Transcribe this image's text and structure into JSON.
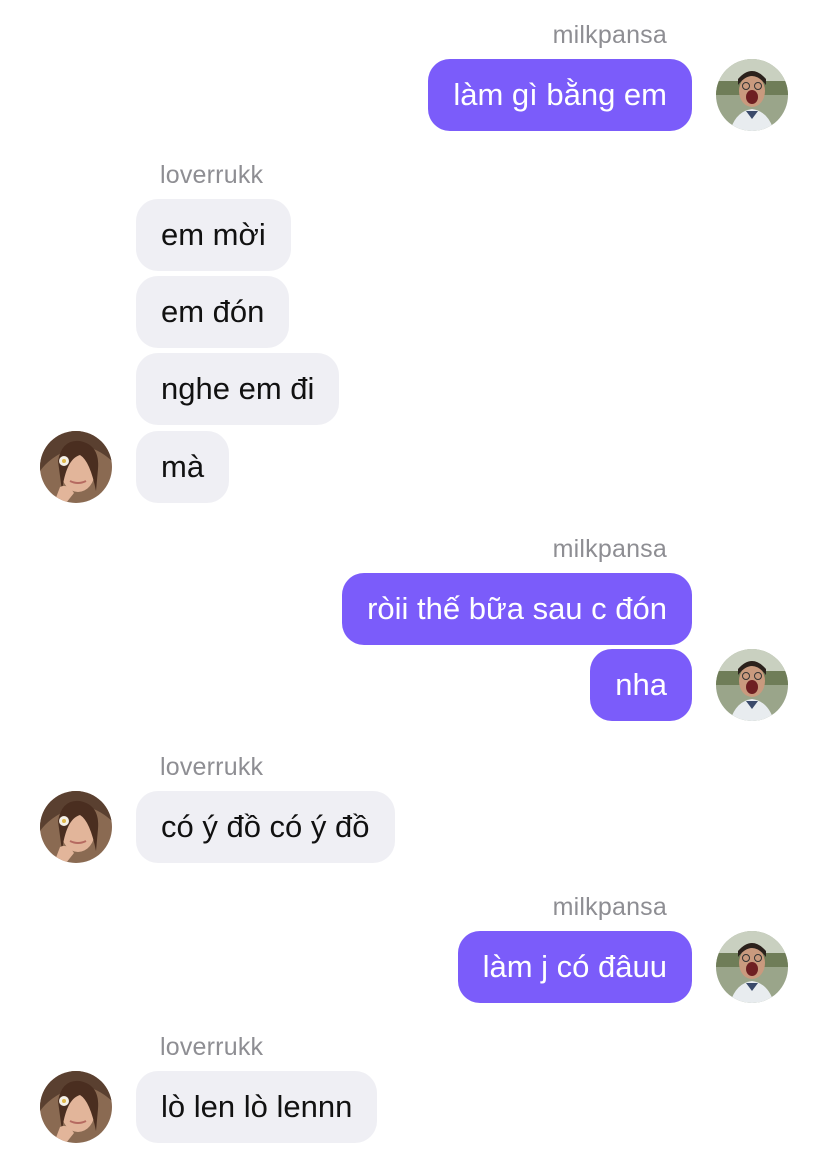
{
  "colors": {
    "outgoing_bubble": "#7b5cfa",
    "incoming_bubble": "#efeff4",
    "sender_name": "#8e8e93"
  },
  "chat": {
    "groups": [
      {
        "direction": "outgoing",
        "sender": "milkpansa",
        "avatar": "avatar-milkpansa",
        "messages": [
          "làm gì bằng em"
        ]
      },
      {
        "direction": "incoming",
        "sender": "loverrukk",
        "avatar": "avatar-loverrukk",
        "messages": [
          "em mời",
          "em đón",
          "nghe em đi",
          "mà"
        ]
      },
      {
        "direction": "outgoing",
        "sender": "milkpansa",
        "avatar": "avatar-milkpansa",
        "messages": [
          "ròii thế bữa sau c đón",
          "nha"
        ]
      },
      {
        "direction": "incoming",
        "sender": "loverrukk",
        "avatar": "avatar-loverrukk",
        "messages": [
          "có ý đồ có ý đồ"
        ]
      },
      {
        "direction": "outgoing",
        "sender": "milkpansa",
        "avatar": "avatar-milkpansa",
        "messages": [
          "làm j có đâuu"
        ]
      },
      {
        "direction": "incoming",
        "sender": "loverrukk",
        "avatar": "avatar-loverrukk",
        "messages": [
          "lò len lò lennn"
        ]
      }
    ]
  }
}
